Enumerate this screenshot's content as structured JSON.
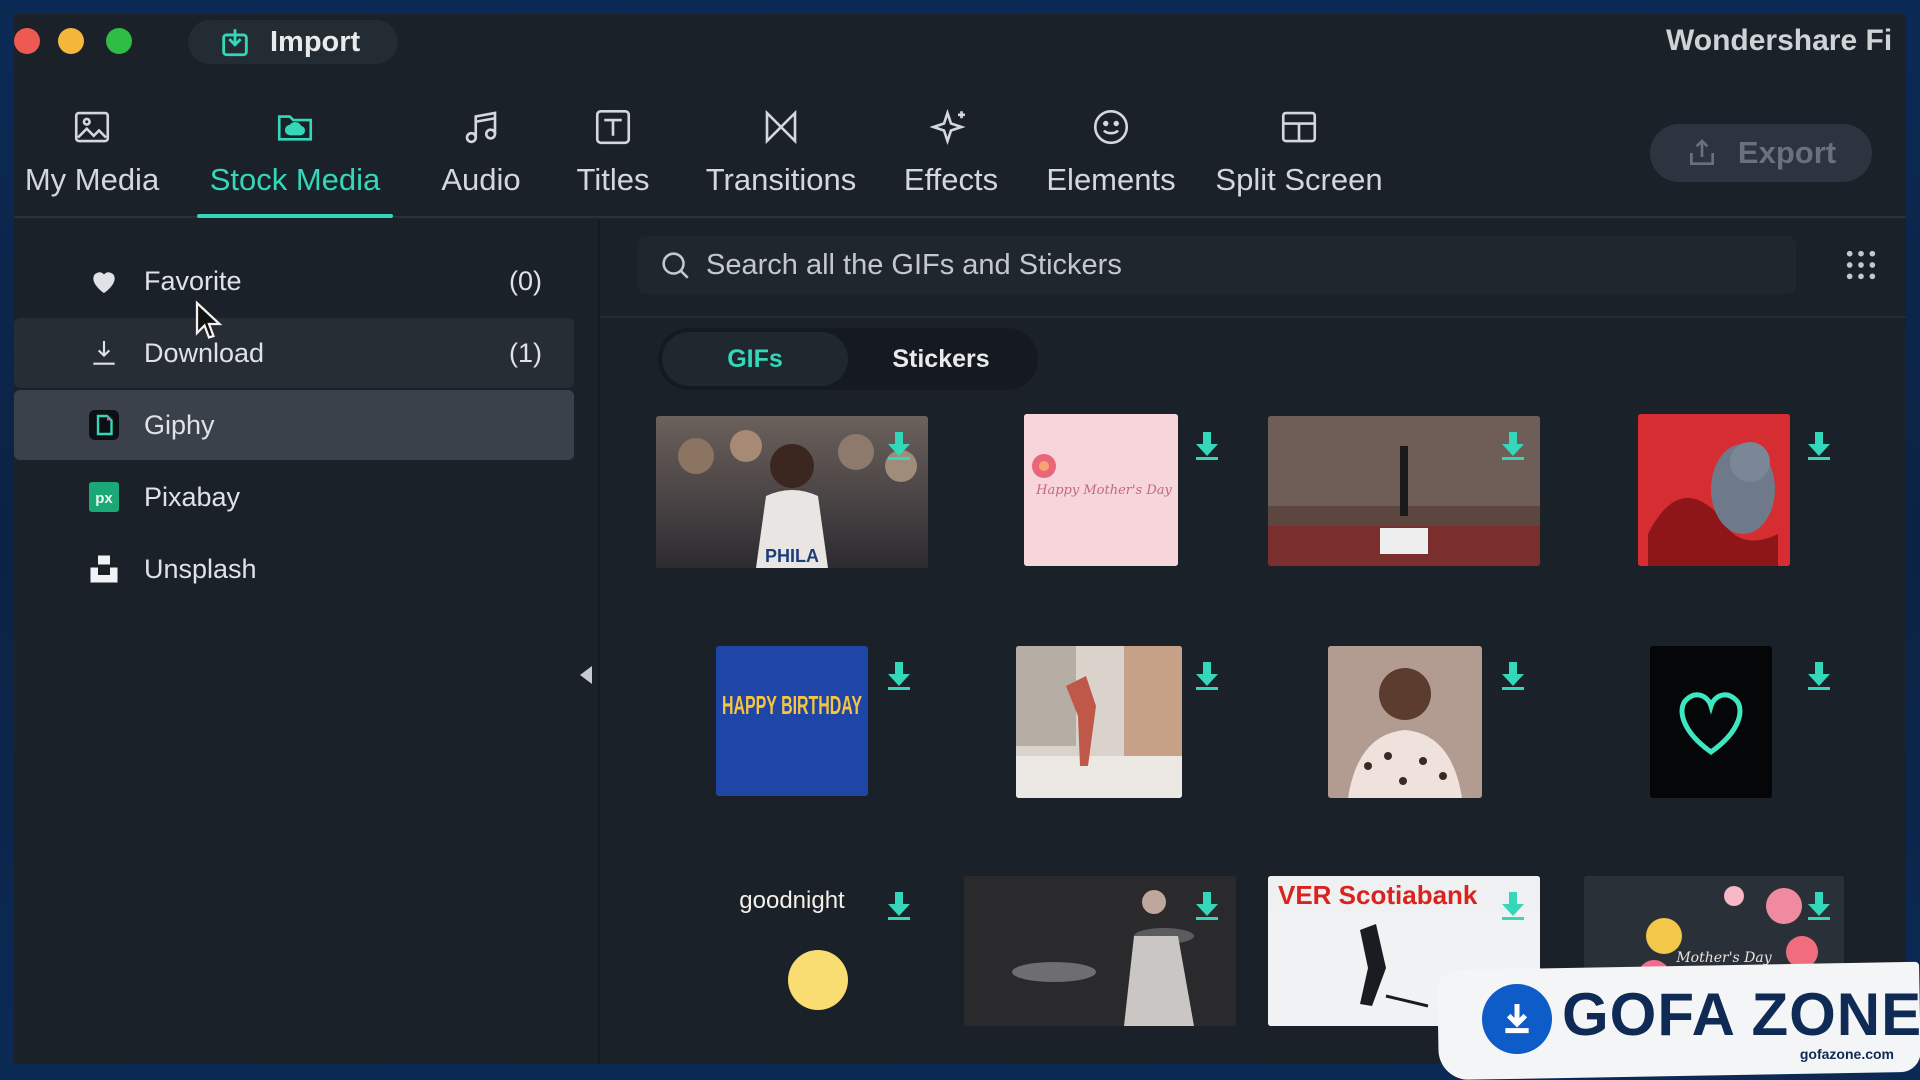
{
  "title_bar": {
    "import_label": "Import",
    "app_title": "Wondershare Fi"
  },
  "toolbar": {
    "tabs": [
      {
        "label": "My Media",
        "icon": "image-icon"
      },
      {
        "label": "Stock Media",
        "icon": "cloud-folder-icon",
        "active": true
      },
      {
        "label": "Audio",
        "icon": "music-note-icon"
      },
      {
        "label": "Titles",
        "icon": "text-icon"
      },
      {
        "label": "Transitions",
        "icon": "bowtie-icon"
      },
      {
        "label": "Effects",
        "icon": "sparkle-icon"
      },
      {
        "label": "Elements",
        "icon": "smiley-icon"
      },
      {
        "label": "Split Screen",
        "icon": "split-screen-icon"
      }
    ],
    "export_label": "Export"
  },
  "sidebar": {
    "items": [
      {
        "label": "Favorite",
        "count": "(0)",
        "icon": "heart-icon"
      },
      {
        "label": "Download",
        "count": "(1)",
        "icon": "download-icon"
      },
      {
        "label": "Giphy",
        "count": "",
        "icon": "giphy-icon",
        "active": true
      },
      {
        "label": "Pixabay",
        "count": "",
        "icon": "pixabay-icon"
      },
      {
        "label": "Unsplash",
        "count": "",
        "icon": "unsplash-icon"
      }
    ]
  },
  "main": {
    "search_placeholder": "Search all the GIFs and Stickers",
    "segments": {
      "gifs": "GIFs",
      "stickers": "Stickers",
      "active": "gifs"
    },
    "thumbnails": [
      {
        "name": "basketball-crowd",
        "text": "PHILA"
      },
      {
        "name": "mothers-day-card",
        "text": "Happy Mother's Day"
      },
      {
        "name": "basketball-arena",
        "text": ""
      },
      {
        "name": "cartoon-cat",
        "text": ""
      },
      {
        "name": "happy-birthday",
        "text": "HAPPY BIRTHDAY"
      },
      {
        "name": "dancer",
        "text": ""
      },
      {
        "name": "man-heart-hands",
        "text": ""
      },
      {
        "name": "neon-heart",
        "text": ""
      },
      {
        "name": "goodnight-moon",
        "text": "goodnight"
      },
      {
        "name": "drummer",
        "text": ""
      },
      {
        "name": "hockey-player",
        "text": "VER Scotiabank"
      },
      {
        "name": "flowers-mothers-day",
        "text": "Mother's Day"
      }
    ]
  },
  "watermark": {
    "text": "GOFA ZONE",
    "sub": "gofazone.com"
  },
  "colors": {
    "accent": "#34d7b9",
    "panel": "#1b2129",
    "sidebar_active": "#3a414a"
  }
}
